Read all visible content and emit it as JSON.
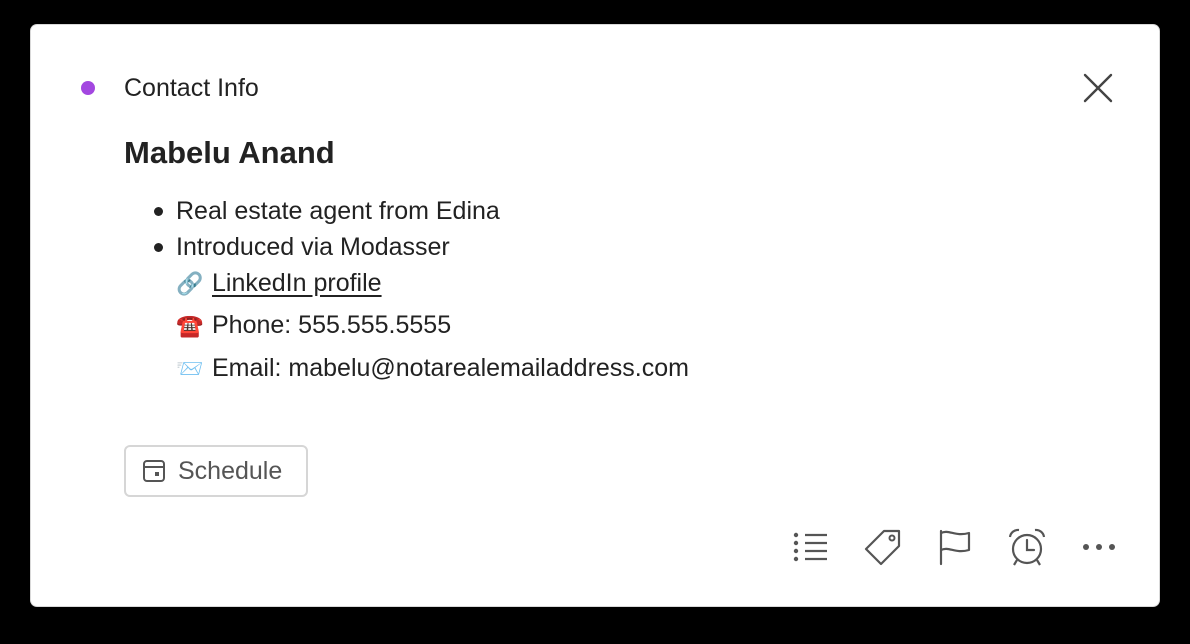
{
  "header": {
    "category_label": "Contact Info",
    "category_color": "#a347e0",
    "close_icon": "close-icon"
  },
  "contact": {
    "name": "Mabelu Anand",
    "notes": [
      "Real estate agent from Edina",
      "Introduced via Modasser"
    ],
    "linkedin": {
      "icon": "🔗",
      "label": "LinkedIn profile"
    },
    "phone": {
      "icon": "☎️",
      "label": "Phone: 555.555.5555"
    },
    "email": {
      "icon": "📨",
      "label": "Email: mabelu@notarealemailaddress.com"
    }
  },
  "actions": {
    "schedule_label": "Schedule"
  },
  "toolbar": {
    "icons": [
      "checklist-icon",
      "tag-icon",
      "flag-icon",
      "alarm-clock-icon",
      "more-options-icon"
    ]
  }
}
